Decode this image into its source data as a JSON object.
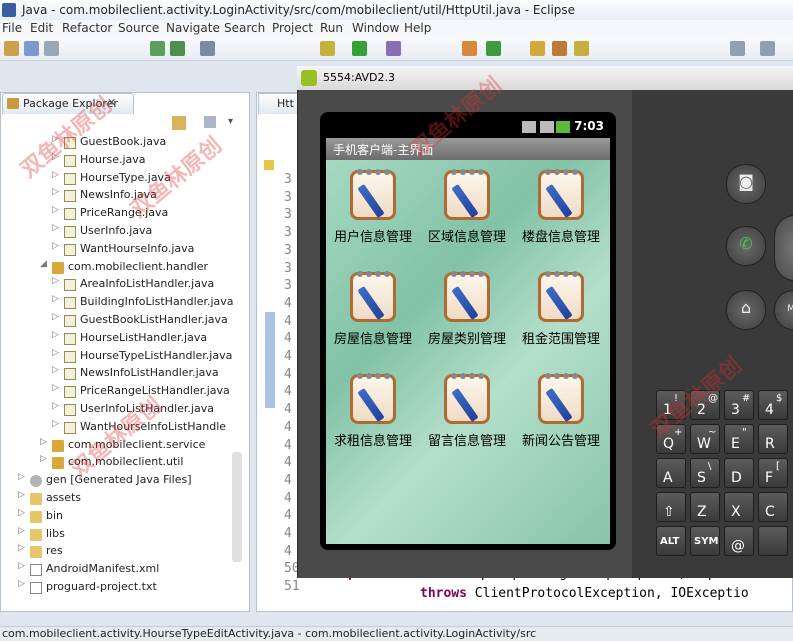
{
  "window": {
    "title": "Java - com.mobileclient.activity.LoginActivity/src/com/mobileclient/util/HttpUtil.java - Eclipse"
  },
  "menu": [
    "File",
    "Edit",
    "Refactor",
    "Source",
    "Navigate",
    "Search",
    "Project",
    "Run",
    "Window",
    "Help"
  ],
  "package_explorer": {
    "tab_label": "Package Explorer",
    "close": "✕",
    "items": [
      {
        "label": "GuestBook.java",
        "type": "java",
        "depth": 4
      },
      {
        "label": "Hourse.java",
        "type": "java",
        "depth": 4
      },
      {
        "label": "HourseType.java",
        "type": "java",
        "depth": 4
      },
      {
        "label": "NewsInfo.java",
        "type": "java",
        "depth": 4
      },
      {
        "label": "PriceRange.java",
        "type": "java",
        "depth": 4
      },
      {
        "label": "UserInfo.java",
        "type": "java",
        "depth": 4
      },
      {
        "label": "WantHourseInfo.java",
        "type": "java",
        "depth": 4
      },
      {
        "label": "com.mobileclient.handler",
        "type": "pkg",
        "depth": 3
      },
      {
        "label": "AreaInfoListHandler.java",
        "type": "java",
        "depth": 4
      },
      {
        "label": "BuildingInfoListHandler.java",
        "type": "java",
        "depth": 4
      },
      {
        "label": "GuestBookListHandler.java",
        "type": "java",
        "depth": 4
      },
      {
        "label": "HourseListHandler.java",
        "type": "java",
        "depth": 4
      },
      {
        "label": "HourseTypeListHandler.java",
        "type": "java",
        "depth": 4
      },
      {
        "label": "NewsInfoListHandler.java",
        "type": "java",
        "depth": 4
      },
      {
        "label": "PriceRangeListHandler.java",
        "type": "java",
        "depth": 4
      },
      {
        "label": "UserInfoListHandler.java",
        "type": "java",
        "depth": 4
      },
      {
        "label": "WantHourseInfoListHandle",
        "type": "java",
        "depth": 4
      },
      {
        "label": "com.mobileclient.service",
        "type": "pkg",
        "depth": 3
      },
      {
        "label": "com.mobileclient.util",
        "type": "pkg",
        "depth": 3
      },
      {
        "label": "gen [Generated Java Files]",
        "type": "gear",
        "depth": 2
      },
      {
        "label": "assets",
        "type": "folder",
        "depth": 2
      },
      {
        "label": "bin",
        "type": "folder",
        "depth": 2
      },
      {
        "label": "libs",
        "type": "folder",
        "depth": 2
      },
      {
        "label": "res",
        "type": "folder",
        "depth": 2
      },
      {
        "label": "AndroidManifest.xml",
        "type": "file",
        "depth": 2
      },
      {
        "label": "proguard-project.txt",
        "type": "file",
        "depth": 2
      }
    ]
  },
  "editor": {
    "tab_label": "Htt",
    "line_nums": [
      "3",
      "3",
      "3",
      "3",
      "3",
      "3",
      "3",
      "4",
      "4",
      "4",
      "4",
      "4",
      "4",
      "4",
      "4",
      "4",
      "4",
      "4",
      "4",
      "4",
      "4",
      "4",
      "50",
      "51"
    ],
    "code_line1_kw": "public static",
    "code_line1_rest": "HttpResponse getHttpResponse(HttpGet",
    "code_line2_kw": "throws",
    "code_line2_rest": "ClientProtocolException, IOExceptio"
  },
  "status": {
    "text": "com.mobileclient.activity.HourseTypeEditActivity.java - com.mobileclient.activity.LoginActivity/src"
  },
  "emulator": {
    "title": "5554:AVD2.3",
    "time": "7:03",
    "app_title": "手机客户端-主界面",
    "grid": [
      "用户信息管理",
      "区域信息管理",
      "楼盘信息管理",
      "房屋信息管理",
      "房屋类别管理",
      "租金范围管理",
      "求租信息管理",
      "留言信息管理",
      "新闻公告管理"
    ],
    "keys": [
      {
        "main": "1",
        "sub": "!"
      },
      {
        "main": "2",
        "sub": "@"
      },
      {
        "main": "3",
        "sub": "#"
      },
      {
        "main": "4",
        "sub": "$"
      },
      {
        "main": "Q",
        "sub": "+"
      },
      {
        "main": "W",
        "sub": "~"
      },
      {
        "main": "E",
        "sub": "\""
      },
      {
        "main": "R",
        "sub": ""
      },
      {
        "main": "A",
        "sub": ""
      },
      {
        "main": "S",
        "sub": "\\"
      },
      {
        "main": "D",
        "sub": ""
      },
      {
        "main": "F",
        "sub": "["
      },
      {
        "main": "⇧",
        "sub": ""
      },
      {
        "main": "Z",
        "sub": ""
      },
      {
        "main": "X",
        "sub": ""
      },
      {
        "main": "C",
        "sub": ""
      },
      {
        "main": "ALT",
        "sub": ""
      },
      {
        "main": "SYM",
        "sub": ""
      },
      {
        "main": "@",
        "sub": ""
      },
      {
        "main": "",
        "sub": ""
      }
    ],
    "camera_icon": "camera-icon",
    "call_icon": "call-icon",
    "home_icon": "home-icon"
  },
  "colors": {
    "accent": "#3a5da0",
    "app_bg": "#9fd2bb"
  }
}
